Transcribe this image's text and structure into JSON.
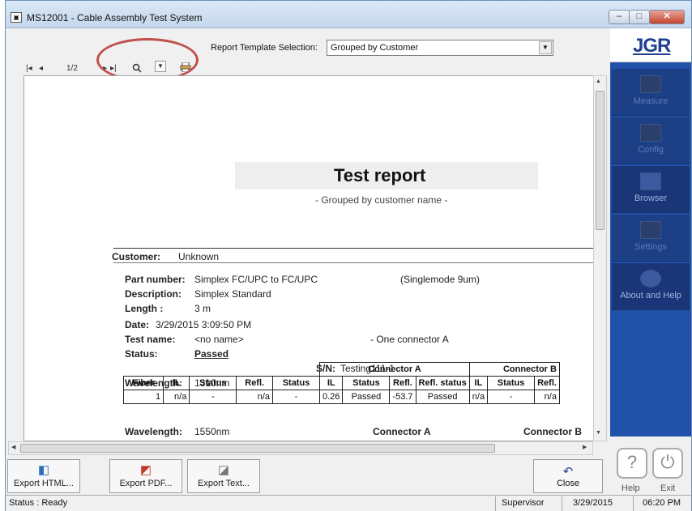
{
  "window": {
    "title": "MS12001 - Cable Assembly Test System",
    "controls": {
      "minimize": "–",
      "maximize": "□",
      "close": "✕"
    }
  },
  "toolbar": {
    "template_label": "Report Template Selection:",
    "template_value": "Grouped  by Customer",
    "page_indicator": "1/2"
  },
  "report": {
    "title": "Test report",
    "subtitle": "- Grouped by customer name -",
    "customer_label": "Customer:",
    "customer_value": "Unknown",
    "part_number_label": "Part number:",
    "part_number_value": "Simplex FC/UPC to FC/UPC",
    "fiber_type": "(Singlemode 9um)",
    "description_label": "Description:",
    "description_value": "Simplex Standard",
    "length_label": "Length :",
    "length_value": "3 m",
    "date_label": "Date:",
    "date_value": "3/29/2015 3:09:50 PM",
    "test_name_label": "Test name:",
    "test_name_value": "<no name>",
    "connector_note": "- One connector A",
    "status_label": "Status:",
    "status_value": "Passed",
    "sn_label": "S/N:",
    "sn_value": "Testing111-1",
    "wavelength_label": "Wavelength:",
    "wl1": "1310nm",
    "wl2": "1550nm",
    "connector_a": "Connector A",
    "connector_b": "Connector B",
    "table_headers": [
      "Fiber",
      "IL",
      "Status",
      "Refl.",
      "Status",
      "IL",
      "Status",
      "Refl.",
      "Refl. status",
      "IL",
      "Status",
      "Refl."
    ],
    "row1": [
      "1",
      "n/a",
      "-",
      "n/a",
      "-",
      "0.26",
      "Passed",
      "-53.7",
      "Passed",
      "n/a",
      "-",
      "n/a"
    ]
  },
  "side_nav": {
    "logo": "JGR",
    "items": [
      "Measure",
      "Config",
      "Browser",
      "Settings",
      "About and Help"
    ],
    "help": "Help",
    "exit": "Exit"
  },
  "bottom": {
    "export_html": "Export HTML...",
    "export_pdf": "Export PDF...",
    "export_text": "Export Text...",
    "close": "Close"
  },
  "statusbar": {
    "status": "Status : Ready",
    "user": "Supervisor",
    "date": "3/29/2015",
    "time": "06:20 PM"
  },
  "colors": {
    "sidebar": "#2151a8",
    "highlight": "#c0504d",
    "title_band": "#eeeeee"
  }
}
